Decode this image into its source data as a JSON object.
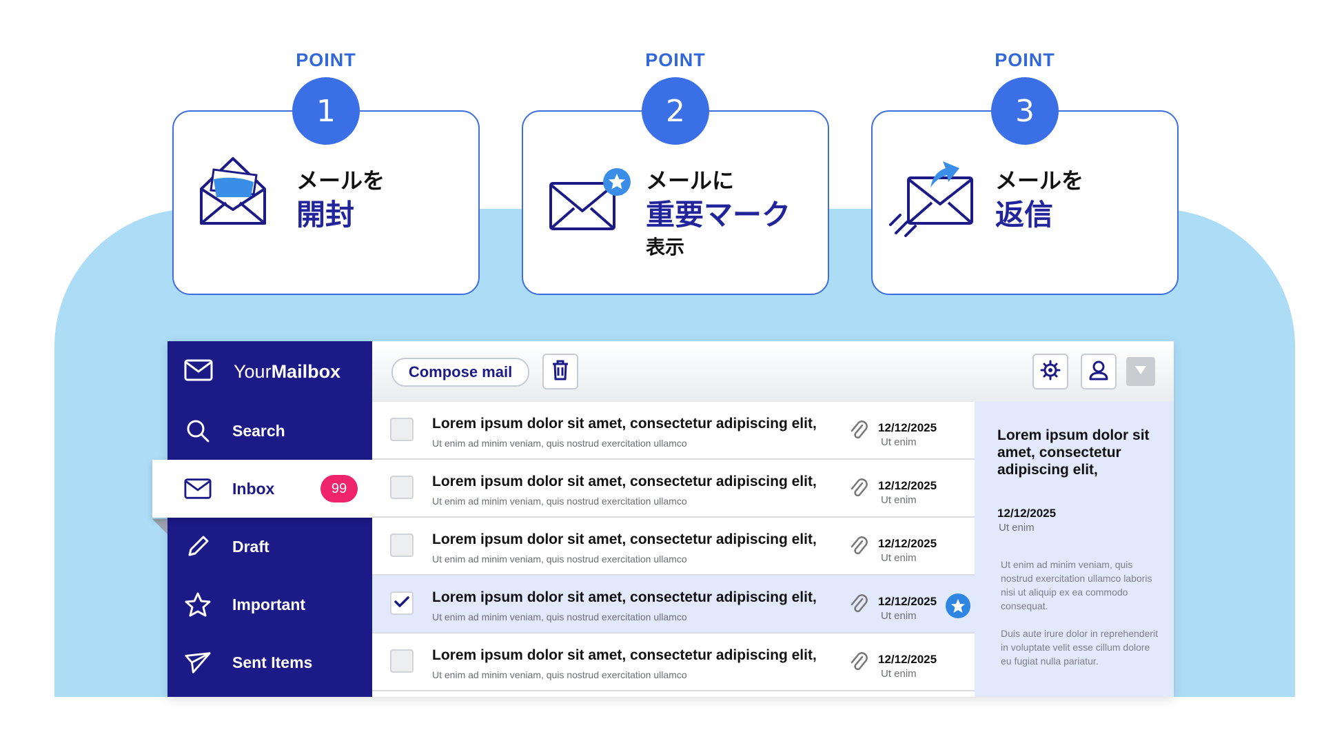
{
  "points": [
    {
      "kicker": "POINT",
      "number": "1",
      "line1": "メールを",
      "big": "開封",
      "line3": "",
      "icon": "open-envelope-icon"
    },
    {
      "kicker": "POINT",
      "number": "2",
      "line1": "メールに",
      "big": "重要マーク",
      "line3": "表示",
      "icon": "starred-envelope-icon"
    },
    {
      "kicker": "POINT",
      "number": "3",
      "line1": "メールを",
      "big": "返信",
      "line3": "",
      "icon": "reply-envelope-icon"
    }
  ],
  "app": {
    "brand": {
      "prefix": "Your",
      "name": "Mailbox"
    },
    "nav": [
      {
        "label": "Search",
        "icon": "search-icon"
      },
      {
        "label": "Inbox",
        "icon": "envelope-icon",
        "badge": "99",
        "active": true
      },
      {
        "label": "Draft",
        "icon": "pencil-icon"
      },
      {
        "label": "Important",
        "icon": "star-icon"
      },
      {
        "label": "Sent Items",
        "icon": "paper-plane-icon"
      }
    ],
    "toolbar": {
      "compose_label": "Compose mail",
      "delete_icon": "trash-icon",
      "settings_icon": "gear-icon",
      "account_icon": "user-icon",
      "menu_icon": "chevron-down-icon"
    },
    "emails": [
      {
        "subject": "Lorem ipsum dolor sit amet, consectetur adipiscing elit,",
        "preview": "Ut enim ad minim veniam, quis nostrud exercitation ullamco",
        "date": "12/12/2025",
        "sub": "Ut enim",
        "checked": false,
        "starred": false
      },
      {
        "subject": "Lorem ipsum dolor sit amet, consectetur adipiscing elit,",
        "preview": "Ut enim ad minim veniam, quis nostrud exercitation ullamco",
        "date": "12/12/2025",
        "sub": "Ut enim",
        "checked": false,
        "starred": false
      },
      {
        "subject": "Lorem ipsum dolor sit amet, consectetur adipiscing elit,",
        "preview": "Ut enim ad minim veniam, quis nostrud exercitation ullamco",
        "date": "12/12/2025",
        "sub": "Ut enim",
        "checked": false,
        "starred": false
      },
      {
        "subject": "Lorem ipsum dolor sit amet, consectetur adipiscing elit,",
        "preview": "Ut enim ad minim veniam, quis nostrud exercitation ullamco",
        "date": "12/12/2025",
        "sub": "Ut enim",
        "checked": true,
        "starred": true
      },
      {
        "subject": "Lorem ipsum dolor sit amet, consectetur adipiscing elit,",
        "preview": "Ut enim ad minim veniam, quis nostrud exercitation ullamco",
        "date": "12/12/2025",
        "sub": "Ut enim",
        "checked": false,
        "starred": false
      }
    ],
    "preview": {
      "title": "Lorem ipsum dolor sit amet, consectetur adipiscing elit,",
      "date": "12/12/2025",
      "sub": "Ut enim",
      "body1": "Ut enim ad minim veniam, quis nostrud exercitation ullamco laboris nisi ut aliquip ex ea commodo consequat.",
      "body2": "Duis aute irure dolor in reprehenderit in voluptate velit esse cillum dolore eu fugiat nulla pariatur."
    }
  },
  "colors": {
    "accent": "#3a6fe5",
    "navy": "#1c1a87",
    "background": "#acdcf6",
    "badge": "#f0246b",
    "selected_row": "#e3e9fc",
    "star": "#2f86e2"
  }
}
